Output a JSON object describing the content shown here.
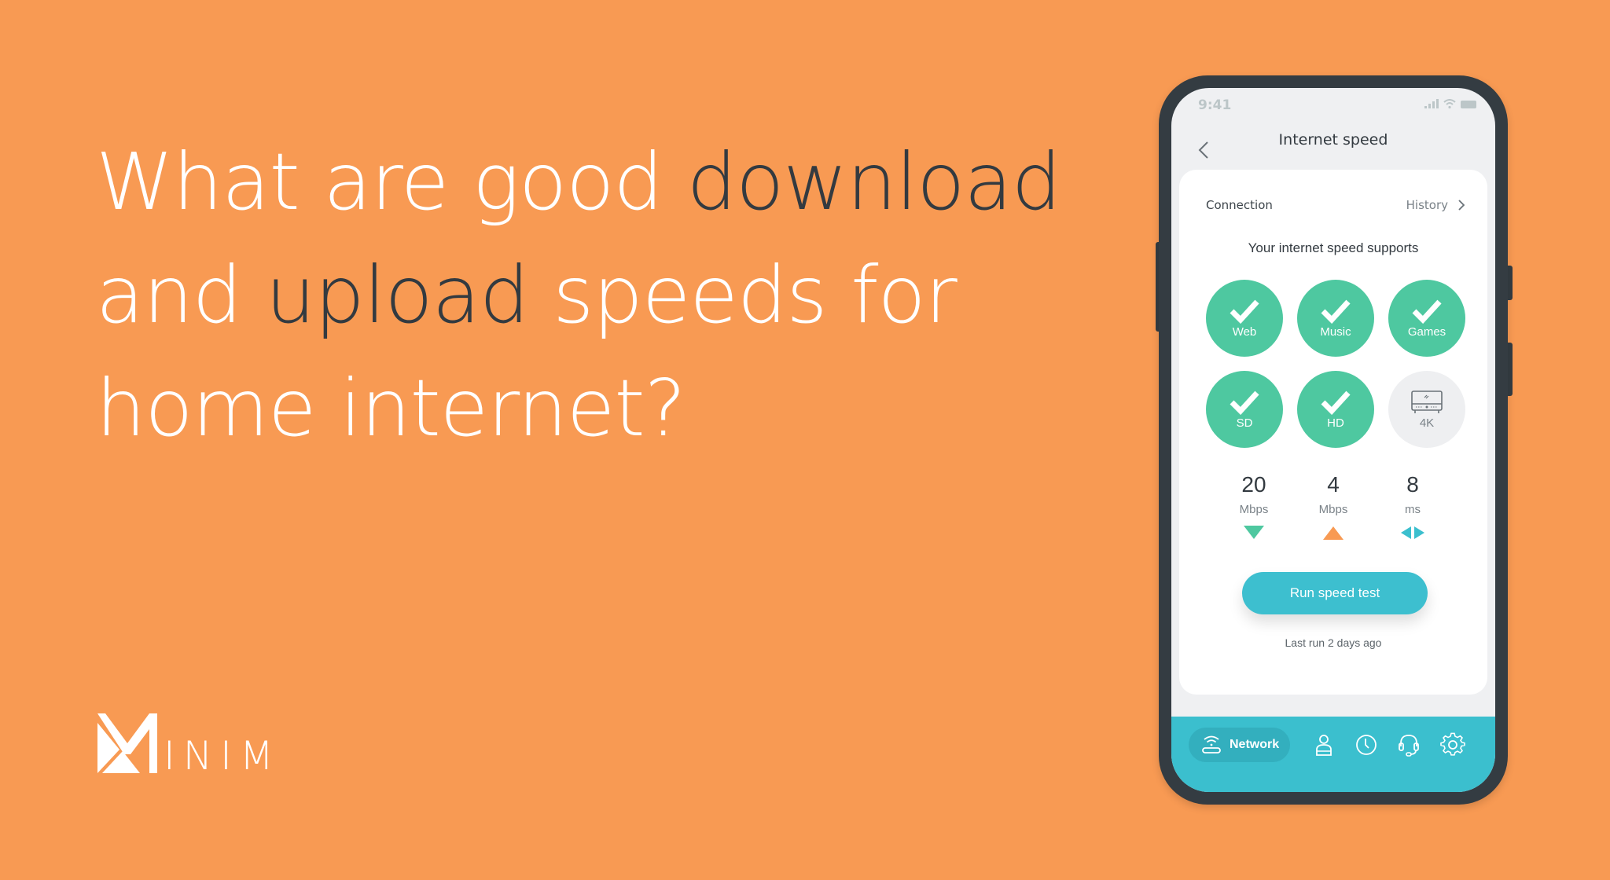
{
  "headline": {
    "line1": [
      {
        "text": "What are good ",
        "emphasis": false
      },
      {
        "text": "download",
        "emphasis": true
      }
    ],
    "line2": [
      {
        "text": "and ",
        "emphasis": false
      },
      {
        "text": "upload",
        "emphasis": true
      },
      {
        "text": " speeds for",
        "emphasis": false
      }
    ],
    "line3": [
      {
        "text": "home internet?",
        "emphasis": false
      }
    ]
  },
  "brand": {
    "logo_text": "INIM",
    "logo_icon": "minim-m-logo-icon"
  },
  "colors": {
    "background": "#F89A53",
    "headline_light": "#FFFFFF",
    "headline_dark": "#333A40",
    "phone_frame": "#343C42",
    "supported_green": "#4EC8A0",
    "accent_teal": "#3BBFCE",
    "upload_orange": "#F89A53"
  },
  "phone": {
    "status_bar": {
      "time": "9:41",
      "icons": [
        "signal-icon",
        "wifi-icon",
        "battery-icon"
      ]
    },
    "nav": {
      "back_icon": "chevron-left-icon",
      "title": "Internet speed"
    },
    "card": {
      "connection_label": "Connection",
      "history_label": "History",
      "history_icon": "chevron-right-icon",
      "supports_title": "Your internet speed supports",
      "activities": [
        {
          "label": "Web",
          "supported": true,
          "icon": "check-icon"
        },
        {
          "label": "Music",
          "supported": true,
          "icon": "check-icon"
        },
        {
          "label": "Games",
          "supported": true,
          "icon": "check-icon"
        },
        {
          "label": "SD",
          "supported": true,
          "icon": "check-icon"
        },
        {
          "label": "HD",
          "supported": true,
          "icon": "check-icon"
        },
        {
          "label": "4K",
          "supported": false,
          "icon": "tv-icon"
        }
      ],
      "metrics": [
        {
          "value": "20",
          "unit": "Mbps",
          "icon": "download-triangle-icon"
        },
        {
          "value": "4",
          "unit": "Mbps",
          "icon": "upload-triangle-icon"
        },
        {
          "value": "8",
          "unit": "ms",
          "icon": "latency-arrows-icon"
        }
      ],
      "run_button_label": "Run speed test",
      "last_run": "Last run 2 days ago"
    },
    "tabbar": {
      "active_tab": {
        "label": "Network",
        "icon": "router-wifi-icon"
      },
      "other_tabs": [
        "person-icon",
        "clock-icon",
        "headset-icon",
        "gear-icon"
      ]
    }
  }
}
